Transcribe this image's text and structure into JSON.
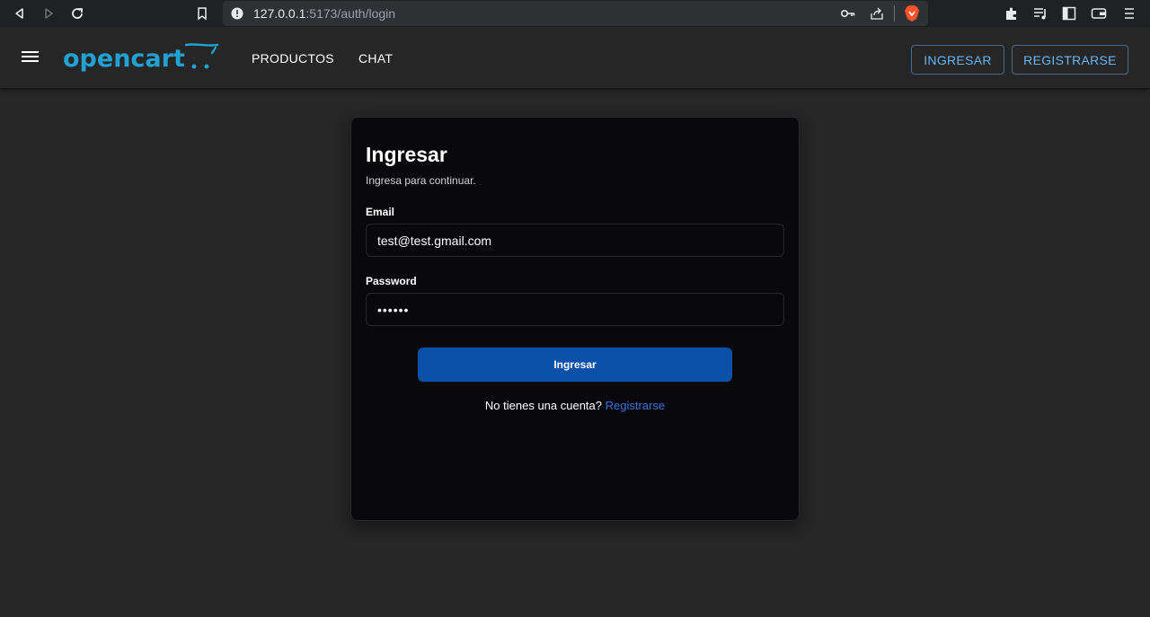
{
  "browser": {
    "url_host": "127.0.0.1",
    "url_path": ":5173/auth/login"
  },
  "header": {
    "logo_text": "opencart",
    "nav": [
      {
        "label": "PRODUCTOS"
      },
      {
        "label": "CHAT"
      }
    ],
    "login_button": "INGRESAR",
    "register_button": "REGISTRARSE"
  },
  "login": {
    "title": "Ingresar",
    "subtitle": "Ingresa para continuar.",
    "email_label": "Email",
    "email_value": "test@test.gmail.com",
    "password_label": "Password",
    "password_value": "••••••",
    "submit_label": "Ingresar",
    "no_account_text": "No tienes una cuenta? ",
    "register_link": "Registrarse"
  },
  "colors": {
    "background": "#262626",
    "card": "#09090b",
    "accent": "#0a4fa8",
    "logo": "#23a1d1",
    "link": "#3b6fd6"
  }
}
